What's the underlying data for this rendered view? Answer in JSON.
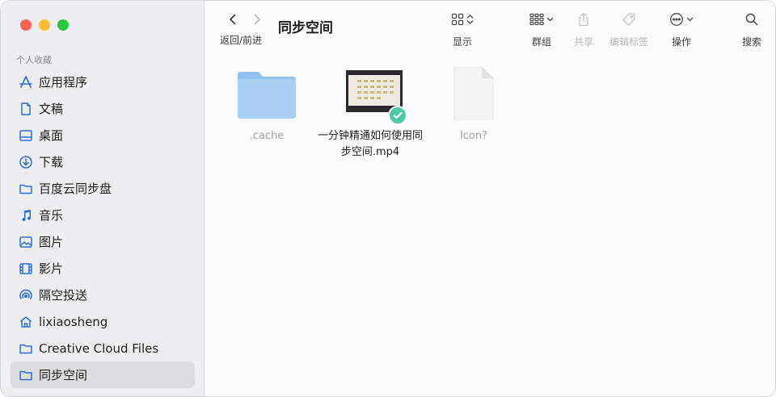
{
  "sidebar": {
    "section_title": "个人收藏",
    "items": [
      {
        "label": "应用程序",
        "icon": "applications-icon"
      },
      {
        "label": "文稿",
        "icon": "document-icon"
      },
      {
        "label": "桌面",
        "icon": "desktop-icon"
      },
      {
        "label": "下载",
        "icon": "download-icon"
      },
      {
        "label": "百度云同步盘",
        "icon": "folder-icon"
      },
      {
        "label": "音乐",
        "icon": "music-icon"
      },
      {
        "label": "图片",
        "icon": "photo-icon"
      },
      {
        "label": "影片",
        "icon": "movie-icon"
      },
      {
        "label": "隔空投送",
        "icon": "airdrop-icon"
      },
      {
        "label": "lixiaosheng",
        "icon": "home-icon"
      },
      {
        "label": "Creative Cloud Files",
        "icon": "folder-icon"
      },
      {
        "label": "同步空间",
        "icon": "folder-icon",
        "selected": true
      }
    ]
  },
  "toolbar": {
    "nav_label": "返回/前进",
    "title": "同步空间",
    "tools": [
      {
        "label": "显示",
        "icon": "grid-view-icon"
      },
      {
        "label": "群组",
        "icon": "group-icon"
      },
      {
        "label": "共享",
        "icon": "share-icon"
      },
      {
        "label": "编辑标签",
        "icon": "tag-icon"
      },
      {
        "label": "操作",
        "icon": "more-icon"
      },
      {
        "label": "搜索",
        "icon": "search-icon"
      }
    ]
  },
  "files": [
    {
      "name": ".cache",
      "type": "folder"
    },
    {
      "name": "一分钟精通如何使用同步空间.mp4",
      "type": "video",
      "synced": true
    },
    {
      "name": "Icon?",
      "type": "document"
    }
  ],
  "colors": {
    "accent": "#2b6ed9",
    "sync_badge": "#4cc9a6",
    "folder": "#a8d0f5"
  }
}
